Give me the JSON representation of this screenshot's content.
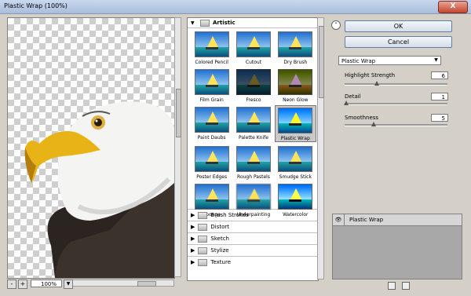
{
  "window": {
    "title": "Plastic Wrap (100%)",
    "close_label": "X"
  },
  "preview": {
    "zoom_value": "100%",
    "zoom_out_label": "-",
    "zoom_in_label": "+"
  },
  "gallery": {
    "open_category": "Artistic",
    "filters": [
      {
        "label": "Colored Pencil"
      },
      {
        "label": "Cutout"
      },
      {
        "label": "Dry Brush"
      },
      {
        "label": "Film Grain"
      },
      {
        "label": "Fresco"
      },
      {
        "label": "Neon Glow"
      },
      {
        "label": "Paint Daubs"
      },
      {
        "label": "Palette Knife"
      },
      {
        "label": "Plastic Wrap"
      },
      {
        "label": "Poster Edges"
      },
      {
        "label": "Rough Pastels"
      },
      {
        "label": "Smudge Stick"
      },
      {
        "label": "Sponge"
      },
      {
        "label": "Underpainting"
      },
      {
        "label": "Watercolor"
      }
    ],
    "categories": [
      "Brush Strokes",
      "Distort",
      "Sketch",
      "Stylize",
      "Texture"
    ]
  },
  "buttons": {
    "ok": "OK",
    "cancel": "Cancel"
  },
  "settings": {
    "filter_select": "Plastic Wrap",
    "params": [
      {
        "label": "Highlight Strength",
        "value": "6"
      },
      {
        "label": "Detail",
        "value": "1"
      },
      {
        "label": "Smoothness",
        "value": "5"
      }
    ]
  },
  "layers": {
    "items": [
      {
        "label": "Plastic Wrap"
      }
    ]
  }
}
